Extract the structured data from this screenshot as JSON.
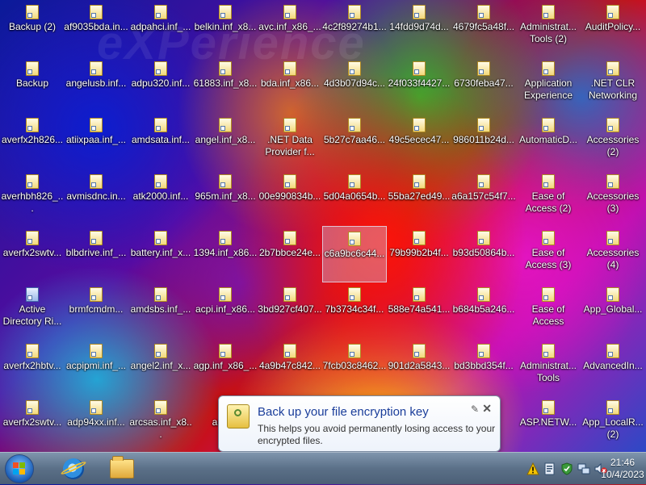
{
  "desktop": {
    "watermark": "eXPerience",
    "icons": [
      {
        "label": "Backup (2)",
        "type": "shortcut"
      },
      {
        "label": "af9035bda.in...",
        "type": "shortcut"
      },
      {
        "label": "adpahci.inf_...",
        "type": "shortcut"
      },
      {
        "label": "belkin.inf_x8...",
        "type": "shortcut"
      },
      {
        "label": "avc.inf_x86_...",
        "type": "shortcut"
      },
      {
        "label": "4c2f89274b1...",
        "type": "shortcut"
      },
      {
        "label": "14fdd9d74d...",
        "type": "shortcut"
      },
      {
        "label": "4679fc5a48f...",
        "type": "shortcut"
      },
      {
        "label": "Administrat... Tools (2)",
        "type": "shortcut"
      },
      {
        "label": "AuditPolicy...",
        "type": "shortcut"
      },
      {
        "label": "Backup",
        "type": "shortcut"
      },
      {
        "label": "angelusb.inf...",
        "type": "shortcut"
      },
      {
        "label": "adpu320.inf...",
        "type": "shortcut"
      },
      {
        "label": "61883.inf_x8...",
        "type": "shortcut"
      },
      {
        "label": "bda.inf_x86...",
        "type": "shortcut"
      },
      {
        "label": "4d3b07d94c...",
        "type": "shortcut"
      },
      {
        "label": "24f033f4427...",
        "type": "shortcut"
      },
      {
        "label": "6730feba47...",
        "type": "shortcut"
      },
      {
        "label": "Application Experience",
        "type": "shortcut"
      },
      {
        "label": ".NET CLR Networking",
        "type": "shortcut"
      },
      {
        "label": "averfx2h826...",
        "type": "shortcut"
      },
      {
        "label": "atiixpaa.inf_...",
        "type": "shortcut"
      },
      {
        "label": "amdsata.inf...",
        "type": "shortcut"
      },
      {
        "label": "angel.inf_x8...",
        "type": "shortcut"
      },
      {
        "label": ".NET Data Provider f...",
        "type": "shortcut"
      },
      {
        "label": "5b27c7aa46...",
        "type": "shortcut"
      },
      {
        "label": "49c5ecec47...",
        "type": "shortcut"
      },
      {
        "label": "986011b24d...",
        "type": "shortcut"
      },
      {
        "label": "AutomaticD...",
        "type": "shortcut"
      },
      {
        "label": "Accessories (2)",
        "type": "shortcut"
      },
      {
        "label": "averhbh826_...",
        "type": "shortcut"
      },
      {
        "label": "avmisdnc.in...",
        "type": "shortcut"
      },
      {
        "label": "atk2000.inf...",
        "type": "shortcut"
      },
      {
        "label": "965m.inf_x8...",
        "type": "shortcut"
      },
      {
        "label": "00e990834b...",
        "type": "shortcut"
      },
      {
        "label": "5d04a0654b...",
        "type": "shortcut"
      },
      {
        "label": "55ba27ed49...",
        "type": "shortcut"
      },
      {
        "label": "a6a157c54f7...",
        "type": "shortcut"
      },
      {
        "label": "Ease of Access (2)",
        "type": "shortcut"
      },
      {
        "label": "Accessories (3)",
        "type": "shortcut"
      },
      {
        "label": "averfx2swtv...",
        "type": "shortcut"
      },
      {
        "label": "blbdrive.inf_...",
        "type": "shortcut"
      },
      {
        "label": "battery.inf_x...",
        "type": "shortcut"
      },
      {
        "label": "1394.inf_x86...",
        "type": "shortcut"
      },
      {
        "label": "2b7bbce24e...",
        "type": "shortcut"
      },
      {
        "label": "c6a9bc6c44...",
        "type": "shortcut"
      },
      {
        "label": "79b99b2b4f...",
        "type": "shortcut"
      },
      {
        "label": "b93d50864b...",
        "type": "shortcut"
      },
      {
        "label": "Ease of Access (3)",
        "type": "shortcut"
      },
      {
        "label": "Accessories (4)",
        "type": "shortcut"
      },
      {
        "label": "Active Directory Ri...",
        "type": "app"
      },
      {
        "label": "brmfcmdm...",
        "type": "shortcut"
      },
      {
        "label": "amdsbs.inf_...",
        "type": "shortcut"
      },
      {
        "label": "acpi.inf_x86...",
        "type": "shortcut"
      },
      {
        "label": "3bd927cf407...",
        "type": "shortcut"
      },
      {
        "label": "7b3734c34f...",
        "type": "shortcut"
      },
      {
        "label": "588e74a541...",
        "type": "shortcut"
      },
      {
        "label": "b684b5a246...",
        "type": "shortcut"
      },
      {
        "label": "Ease of Access",
        "type": "shortcut"
      },
      {
        "label": "App_Global...",
        "type": "shortcut"
      },
      {
        "label": "averfx2hbtv...",
        "type": "shortcut"
      },
      {
        "label": "acpipmi.inf_...",
        "type": "shortcut"
      },
      {
        "label": "angel2.inf_x...",
        "type": "shortcut"
      },
      {
        "label": "agp.inf_x86_...",
        "type": "shortcut"
      },
      {
        "label": "4a9b47c842...",
        "type": "shortcut"
      },
      {
        "label": "7fcb03c8462...",
        "type": "shortcut"
      },
      {
        "label": "901d2a5843...",
        "type": "shortcut"
      },
      {
        "label": "bd3bbd354f...",
        "type": "shortcut"
      },
      {
        "label": "Administrat... Tools",
        "type": "shortcut"
      },
      {
        "label": "AdvancedIn...",
        "type": "shortcut"
      },
      {
        "label": "averfx2swtv...",
        "type": "shortcut"
      },
      {
        "label": "adp94xx.inf...",
        "type": "shortcut"
      },
      {
        "label": "arcsas.inf_x8...",
        "type": "shortcut"
      },
      {
        "label": "arc.inf",
        "type": "shortcut"
      },
      {
        "label": "",
        "type": "hidden"
      },
      {
        "label": "",
        "type": "hidden"
      },
      {
        "label": "",
        "type": "hidden"
      },
      {
        "label": "a",
        "type": "partial"
      },
      {
        "label": "ASP.NETW...",
        "type": "shortcut"
      },
      {
        "label": "App_LocalR... (2)",
        "type": "shortcut"
      }
    ]
  },
  "balloon": {
    "title": "Back up your file encryption key",
    "body": "This helps you avoid permanently losing access to your encrypted files.",
    "options_glyph": "✎",
    "close_glyph": "✕"
  },
  "taskbar": {
    "start_button": "start-orb",
    "pinned": [
      {
        "name": "internet-explorer",
        "label": "Internet Explorer"
      },
      {
        "name": "windows-explorer",
        "label": "Windows Explorer"
      }
    ],
    "tray_icons": [
      "warning-icon",
      "action-center-icon",
      "security-check-icon",
      "network-icon",
      "volume-muted-icon"
    ],
    "clock": {
      "time": "21:46",
      "date": "10/4/2023"
    }
  }
}
